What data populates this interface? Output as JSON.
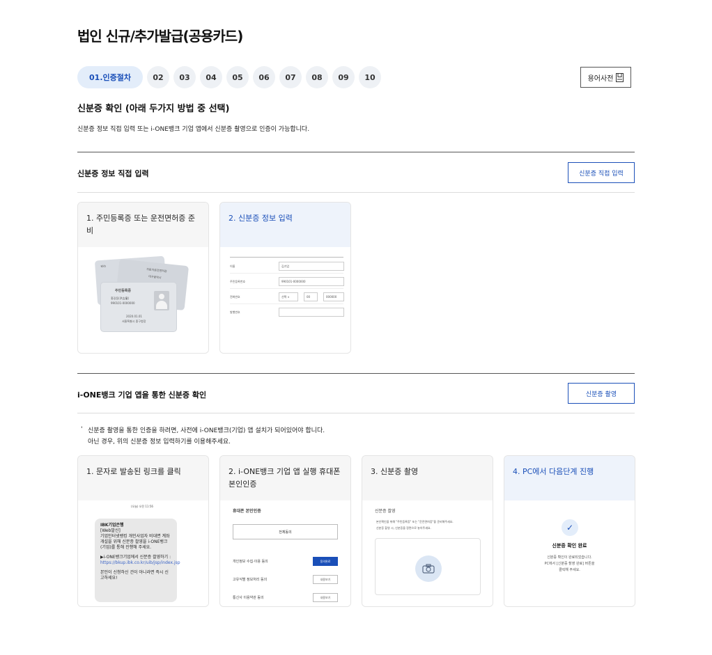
{
  "page_title": "법인 신규/추가발급(공용카드)",
  "steps": [
    "01.인증절차",
    "02",
    "03",
    "04",
    "05",
    "06",
    "07",
    "08",
    "09",
    "10"
  ],
  "glossary": {
    "label": "용어사전",
    "icon": "book-icon"
  },
  "section": {
    "title": "신분증 확인 (아래 두가지 방법 중 선택)",
    "desc": "신분증 정보 직접 입력 또는 i-ONE뱅크 기업 앱에서 신분증 촬영으로 인증이 가능합니다."
  },
  "direct": {
    "title": "신분증 정보 직접 입력",
    "button": "신분증 직접 입력",
    "cards": [
      {
        "title": "1. 주민등록증 또는 운전면허증 준비"
      },
      {
        "title": "2. 신분증 정보 입력"
      }
    ],
    "id_illustration": {
      "back_title": "자동차운전면허증",
      "back_sub": "대구광역시",
      "name_title": "주민등록증",
      "name": "홍길동(洪吉童)",
      "number": "990101-0000000",
      "date": "2020.01.01",
      "issuer": "서울특별시 중구청장",
      "back_label": "Kkb"
    },
    "form_illustration": {
      "rows": [
        {
          "label": "이름",
          "value": "김기업"
        },
        {
          "label": "주민등록번호",
          "value": "990101-0000000"
        },
        {
          "label": "전화번호",
          "sel": "선택 ∨",
          "mid": "00",
          "end": "000000"
        },
        {
          "label": "발행번호",
          "value": ""
        }
      ]
    }
  },
  "app": {
    "title": "i-ONE뱅크 기업 앱을 통한 신분증 확인",
    "button": "신분증 촬영",
    "note_lines": [
      "신분증 촬영을 통한 인증을 하려면, 사전에 i-ONE뱅크(기업) 앱 설치가 되어있어야 합니다.",
      "아닌 경우, 위의 신분증 정보 입력하기를 이용해주세요."
    ],
    "cards": [
      {
        "title": "1. 문자로 발송된 링크를 클릭"
      },
      {
        "title": "2. i-ONE뱅크 기업 앱 실행 휴대폰 본인인증"
      },
      {
        "title": "3. 신분증 촬영"
      },
      {
        "title": "4. PC에서 다음단계 진행"
      }
    ],
    "sms": {
      "time": "(오늘) 오전 11:56",
      "sender": "IBK기업은행",
      "body1": "[Web발신]\n기업인터넷뱅킹 개인사업자 비대면 계좌개설을 위해 신분증 촬영을 i-ONE뱅크(기업)를 통해 진행해 주세요.",
      "body2_prefix": "▶i-ONE뱅크기업에서 신분증 촬영하기 : ",
      "link": "https://bkup.ibk.co.kr/uib/jsp/index.jsp",
      "body3": "본인이 신청하신 건이 아니라면 즉시 신고하세요!"
    },
    "auth": {
      "title": "휴대폰 본인인증",
      "all_agree": "전체동의",
      "items": [
        {
          "label": "개인정보 수집·이용 동의",
          "btn": "동의완료",
          "on": true
        },
        {
          "label": "고유식별 정보처리 동의",
          "btn": "내용보기",
          "on": false
        },
        {
          "label": "통신사 이용약관 동의",
          "btn": "내용보기",
          "on": false
        }
      ]
    },
    "capture": {
      "title": "신분증 촬영",
      "line1": "본인확인을 위해 \"주민등록증\" 또는 \"운전면허증\"을 준비해주세요.",
      "line2": "신분증 촬영 시, 신분증을 정면으로 놓아주세요."
    },
    "done": {
      "title": "신분증 확인 완료",
      "line1": "신분증 확인이 완료되었습니다.",
      "line2": "PC에서 [신분증 촬영 완료] 버튼을",
      "line3": "클릭해 주세요."
    }
  }
}
